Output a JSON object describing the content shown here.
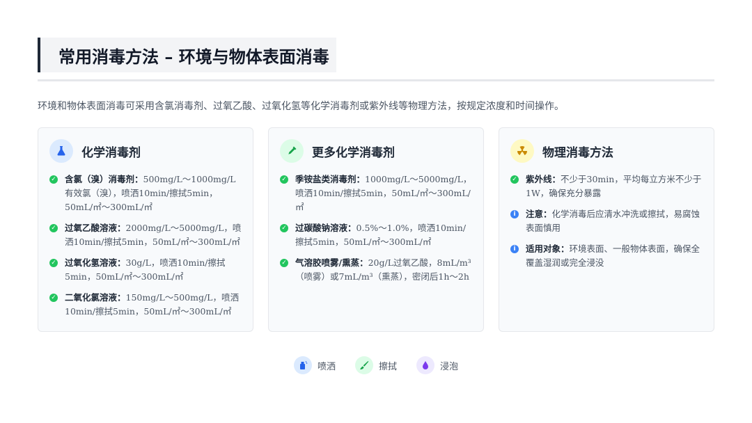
{
  "header": {
    "title": "常用消毒方法 – 环境与物体表面消毒",
    "intro": "环境和物体表面消毒可采用含氯消毒剂、过氧乙酸、过氧化氢等化学消毒剂或紫外线等物理方法，按规定浓度和时间操作。"
  },
  "cards": [
    {
      "title": "化学消毒剂",
      "icon": "flask-icon",
      "icon_color": "#3b82f6",
      "items": [
        {
          "term": "含氯（溴）消毒剂：",
          "text": "500mg/L～1000mg/L有效氯（溴），喷洒10min/擦拭5min，50mL/㎡～300mL/㎡"
        },
        {
          "term": "过氧乙酸溶液：",
          "text": "2000mg/L～5000mg/L，喷洒10min/擦拭5min，50mL/㎡～300mL/㎡"
        },
        {
          "term": "过氧化氢溶液：",
          "text": "30g/L，喷洒10min/擦拭5min，50mL/㎡～300mL/㎡"
        },
        {
          "term": "二氧化氯溶液：",
          "text": "150mg/L～500mg/L，喷洒10min/擦拭5min，50mL/㎡～300mL/㎡"
        }
      ]
    },
    {
      "title": "更多化学消毒剂",
      "icon": "dropper-icon",
      "icon_color": "#22c55e",
      "items": [
        {
          "term": "季铵盐类消毒剂：",
          "text": "1000mg/L～5000mg/L，喷洒10min/擦拭5min，50mL/㎡～300mL/㎡"
        },
        {
          "term": "过碳酸钠溶液：",
          "text": "0.5%～1.0%，喷洒10min/擦拭5min，50mL/㎡～300mL/㎡"
        },
        {
          "term": "气溶胶喷雾/熏蒸：",
          "text": "20g/L过氧乙酸，8mL/m³（喷雾）或7mL/m³（熏蒸），密闭后1h～2h"
        }
      ]
    },
    {
      "title": "物理消毒方法",
      "icon": "radiation-icon",
      "icon_color": "#eab308",
      "items": [
        {
          "term": "紫外线：",
          "text": "不少于30min，平均每立方米不少于1W，确保充分暴露",
          "kind": "check"
        },
        {
          "term": "注意：",
          "text": "化学消毒后应清水冲洗或擦拭，易腐蚀表面慎用",
          "kind": "info"
        },
        {
          "term": "适用对象：",
          "text": "环境表面、一般物体表面，确保全覆盖湿润或完全浸没",
          "kind": "info"
        }
      ]
    }
  ],
  "legend": [
    {
      "label": "喷洒",
      "icon": "spray-bottle-icon"
    },
    {
      "label": "擦拭",
      "icon": "brush-icon"
    },
    {
      "label": "浸泡",
      "icon": "drop-icon"
    }
  ]
}
